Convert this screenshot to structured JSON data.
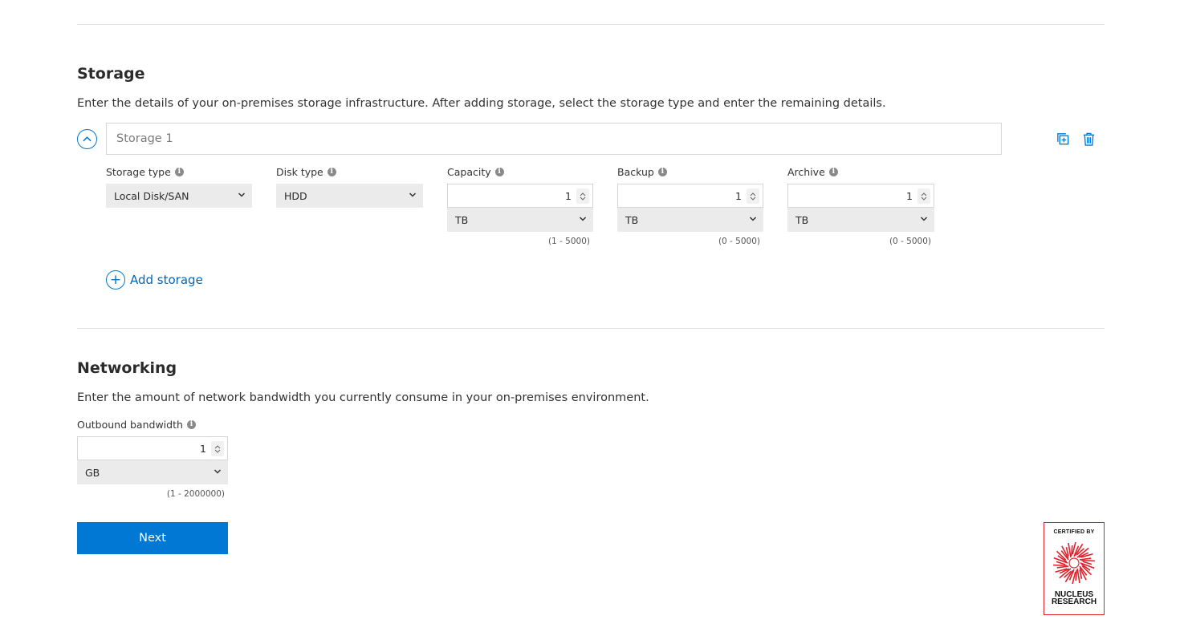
{
  "storage": {
    "title": "Storage",
    "description": "Enter the details of your on-premises storage infrastructure. After adding storage, select the storage type and enter the remaining details.",
    "item": {
      "name_placeholder": "Storage 1",
      "fields": {
        "storage_type": {
          "label": "Storage type",
          "value": "Local Disk/SAN"
        },
        "disk_type": {
          "label": "Disk type",
          "value": "HDD"
        },
        "capacity": {
          "label": "Capacity",
          "value": "1",
          "unit": "TB",
          "range": "(1 - 5000)"
        },
        "backup": {
          "label": "Backup",
          "value": "1",
          "unit": "TB",
          "range": "(0 - 5000)"
        },
        "archive": {
          "label": "Archive",
          "value": "1",
          "unit": "TB",
          "range": "(0 - 5000)"
        }
      }
    },
    "add_label": "Add storage"
  },
  "networking": {
    "title": "Networking",
    "description": "Enter the amount of network bandwidth you currently consume in your on-premises environment.",
    "outbound": {
      "label": "Outbound bandwidth",
      "value": "1",
      "unit": "GB",
      "range": "(1 - 2000000)"
    }
  },
  "next_label": "Next",
  "badge": {
    "line1": "CERTIFIED BY",
    "line2": "NUCLEUS",
    "line3": "RESEARCH"
  },
  "colors": {
    "accent": "#0078d4",
    "badge_red": "#e0202a"
  }
}
